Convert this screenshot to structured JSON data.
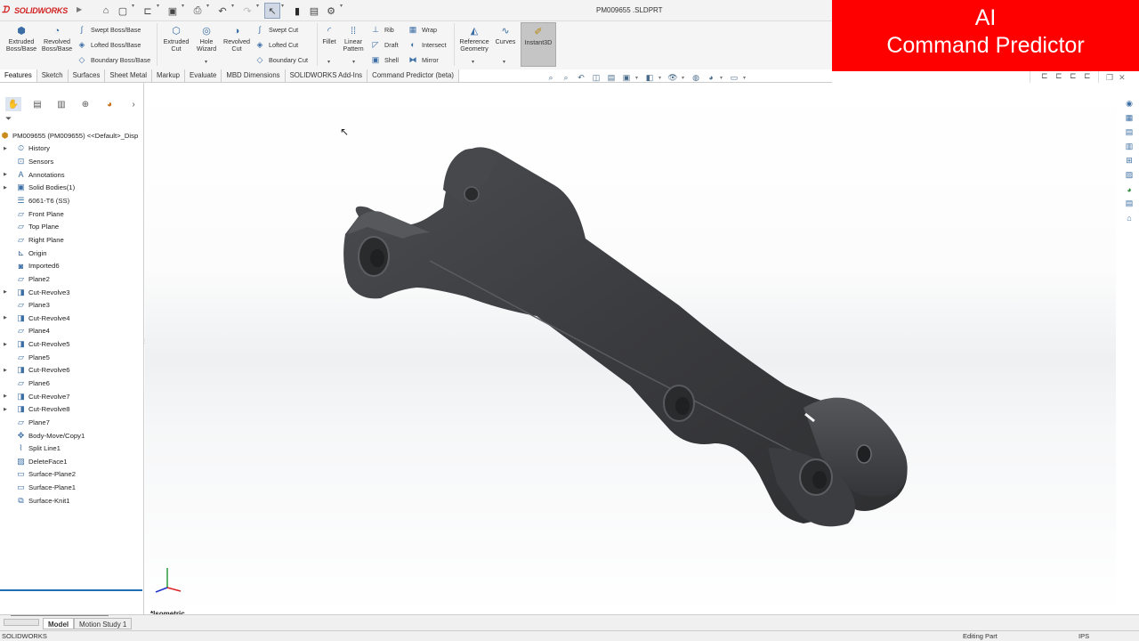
{
  "app": {
    "logo_text": "SOLIDWORKS",
    "document_title": "PM009655 .SLDPRT"
  },
  "banner": {
    "line1": "AI",
    "line2": "Command Predictor",
    "color": "#ff0000"
  },
  "quick_access": [
    "home-icon",
    "new-icon",
    "open-icon",
    "save-icon",
    "print-icon",
    "undo-icon",
    "redo-icon",
    "select-icon",
    "rebuild-icon",
    "file-properties-icon",
    "options-icon"
  ],
  "command_manager": {
    "extruded_boss": "Extruded\nBoss/Base",
    "revolved_boss": "Revolved\nBoss/Base",
    "swept_boss": "Swept Boss/Base",
    "lofted_boss": "Lofted Boss/Base",
    "boundary_boss": "Boundary Boss/Base",
    "extruded_cut": "Extruded\nCut",
    "hole_wizard": "Hole\nWizard",
    "revolved_cut": "Revolved\nCut",
    "swept_cut": "Swept Cut",
    "lofted_cut": "Lofted Cut",
    "boundary_cut": "Boundary Cut",
    "fillet": "Fillet",
    "linear_pattern": "Linear\nPattern",
    "rib": "Rib",
    "draft": "Draft",
    "shell": "Shell",
    "wrap": "Wrap",
    "intersect": "Intersect",
    "mirror": "Mirror",
    "reference_geometry": "Reference\nGeometry",
    "curves": "Curves",
    "instant3d": "Instant3D"
  },
  "tabs": [
    "Features",
    "Sketch",
    "Surfaces",
    "Sheet Metal",
    "Markup",
    "Evaluate",
    "MBD Dimensions",
    "SOLIDWORKS Add-Ins",
    "Command Predictor (beta)"
  ],
  "feature_tree": {
    "root": "PM009655  (PM009655) <<Default>_Disp",
    "items": [
      {
        "label": "History",
        "icon": "history-icon",
        "expandable": true
      },
      {
        "label": "Sensors",
        "icon": "sensor-icon",
        "expandable": false
      },
      {
        "label": "Annotations",
        "icon": "annotations-icon",
        "expandable": true
      },
      {
        "label": "Solid Bodies(1)",
        "icon": "solid-bodies-icon",
        "expandable": true
      },
      {
        "label": "6061-T6 (SS)",
        "icon": "material-icon",
        "expandable": false
      },
      {
        "label": "Front Plane",
        "icon": "plane-icon",
        "expandable": false
      },
      {
        "label": "Top Plane",
        "icon": "plane-icon",
        "expandable": false
      },
      {
        "label": "Right Plane",
        "icon": "plane-icon",
        "expandable": false
      },
      {
        "label": "Origin",
        "icon": "origin-icon",
        "expandable": false
      },
      {
        "label": "Imported6",
        "icon": "imported-body-icon",
        "expandable": false
      },
      {
        "label": "Plane2",
        "icon": "plane-icon",
        "expandable": false
      },
      {
        "label": "Cut-Revolve3",
        "icon": "cut-revolve-icon",
        "expandable": true
      },
      {
        "label": "Plane3",
        "icon": "plane-icon",
        "expandable": false
      },
      {
        "label": "Cut-Revolve4",
        "icon": "cut-revolve-icon",
        "expandable": true
      },
      {
        "label": "Plane4",
        "icon": "plane-icon",
        "expandable": false
      },
      {
        "label": "Cut-Revolve5",
        "icon": "cut-revolve-icon",
        "expandable": true
      },
      {
        "label": "Plane5",
        "icon": "plane-icon",
        "expandable": false
      },
      {
        "label": "Cut-Revolve6",
        "icon": "cut-revolve-icon",
        "expandable": true
      },
      {
        "label": "Plane6",
        "icon": "plane-icon",
        "expandable": false
      },
      {
        "label": "Cut-Revolve7",
        "icon": "cut-revolve-icon",
        "expandable": true
      },
      {
        "label": "Cut-Revolve8",
        "icon": "cut-revolve-icon",
        "expandable": true
      },
      {
        "label": "Plane7",
        "icon": "plane-icon",
        "expandable": false
      },
      {
        "label": "Body-Move/Copy1",
        "icon": "move-copy-icon",
        "expandable": false
      },
      {
        "label": "Split Line1",
        "icon": "split-line-icon",
        "expandable": false
      },
      {
        "label": "DeleteFace1",
        "icon": "delete-face-icon",
        "expandable": false
      },
      {
        "label": "Surface-Plane2",
        "icon": "surface-plane-icon",
        "expandable": false
      },
      {
        "label": "Surface-Plane1",
        "icon": "surface-plane-icon",
        "expandable": false
      },
      {
        "label": "Surface-Knit1",
        "icon": "surface-knit-icon",
        "expandable": false
      }
    ]
  },
  "viewport": {
    "view_label": "*Isometric"
  },
  "bottom_tabs": [
    "Model",
    "Motion Study 1"
  ],
  "status": {
    "left": "SOLIDWORKS",
    "mode": "Editing Part",
    "units": "IPS"
  }
}
